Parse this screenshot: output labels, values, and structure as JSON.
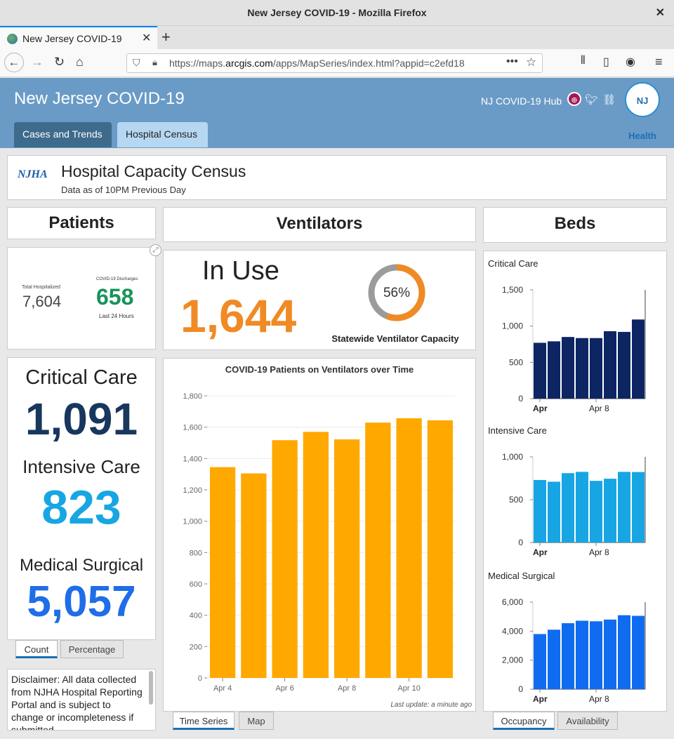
{
  "browser": {
    "window_title": "New Jersey COVID-19 - Mozilla Firefox",
    "tab_title": "New Jersey COVID-19",
    "url_prefix": "https://maps.",
    "url_domain": "arcgis.com",
    "url_rest": "/apps/MapSeries/index.html?appid=c2efd18"
  },
  "app": {
    "title": "New Jersey COVID-19",
    "hub_label": "NJ COVID-19 Hub",
    "logo_text": "NJ Health",
    "tabs": [
      "Cases and Trends",
      "Hospital Census"
    ],
    "active_tab": "Hospital Census"
  },
  "census": {
    "logo_text": "NJHA",
    "title": "Hospital Capacity Census",
    "subtitle": "Data as of 10PM Previous Day"
  },
  "patients": {
    "heading": "Patients",
    "total_label": "Total Hospitalized",
    "total_value": "7,604",
    "discharges_label": "COVID-19 Discharges",
    "discharges_value": "658",
    "discharges_period": "Last 24 Hours",
    "critical_label": "Critical Care",
    "critical_value": "1,091",
    "intensive_label": "Intensive Care",
    "intensive_value": "823",
    "medsurg_label": "Medical Surgical",
    "medsurg_value": "5,057",
    "tabs": [
      "Count",
      "Percentage"
    ],
    "disclaimer": "Disclaimer:  All data collected from NJHA Hospital Reporting Portal and is subject to change or incompleteness if submitted"
  },
  "ventilators": {
    "heading": "Ventilators",
    "in_use_label": "In Use",
    "in_use_value": "1,644",
    "capacity_pct": 56,
    "capacity_text": "56%",
    "capacity_label": "Statewide Ventilator Capacity",
    "last_update": "Last update: a minute ago",
    "tabs": [
      "Time Series",
      "Map"
    ]
  },
  "beds": {
    "heading": "Beds",
    "tabs": [
      "Occupancy",
      "Availability"
    ]
  },
  "colors": {
    "orange": "#f08a24",
    "vent_bar": "#ffa800",
    "critical_navy": "#0d2563",
    "intensive_cyan": "#17a6e3",
    "medsurg_blue": "#0f6cf0",
    "critical_text": "#17375e",
    "discharge_green": "#19935a"
  },
  "chart_data": [
    {
      "type": "bar",
      "title": "COVID-19 Patients on Ventilators over Time",
      "x_ticks": [
        "Apr 4",
        "Apr 6",
        "Apr 8",
        "Apr 10"
      ],
      "categories": [
        "Apr 4",
        "Apr 5",
        "Apr 6",
        "Apr 7",
        "Apr 8",
        "Apr 9",
        "Apr 10",
        "Apr 11"
      ],
      "values": [
        1345,
        1305,
        1517,
        1570,
        1522,
        1629,
        1657,
        1644
      ],
      "ylim": [
        0,
        1800
      ],
      "y_ticks": [
        "0",
        "200",
        "400",
        "600",
        "800",
        "1,000",
        "1,200",
        "1,400",
        "1,600",
        "1,800"
      ],
      "grid": true
    },
    {
      "type": "bar",
      "title": "Critical Care",
      "x_ticks": [
        "Apr",
        "Apr 8"
      ],
      "values": [
        770,
        790,
        850,
        835,
        835,
        930,
        920,
        1091
      ],
      "ylim": [
        0,
        1500
      ],
      "y_ticks": [
        "0",
        "500",
        "1,000",
        "1,500"
      ]
    },
    {
      "type": "bar",
      "title": "Intensive Care",
      "x_ticks": [
        "Apr",
        "Apr 8"
      ],
      "values": [
        730,
        710,
        810,
        825,
        720,
        745,
        825,
        823
      ],
      "ylim": [
        0,
        1000
      ],
      "y_ticks": [
        "0",
        "500",
        "1,000"
      ]
    },
    {
      "type": "bar",
      "title": "Medical Surgical",
      "x_ticks": [
        "Apr",
        "Apr 8"
      ],
      "values": [
        3800,
        4100,
        4550,
        4720,
        4680,
        4800,
        5100,
        5057
      ],
      "ylim": [
        0,
        6000
      ],
      "y_ticks": [
        "0",
        "2,000",
        "4,000",
        "6,000"
      ]
    }
  ]
}
